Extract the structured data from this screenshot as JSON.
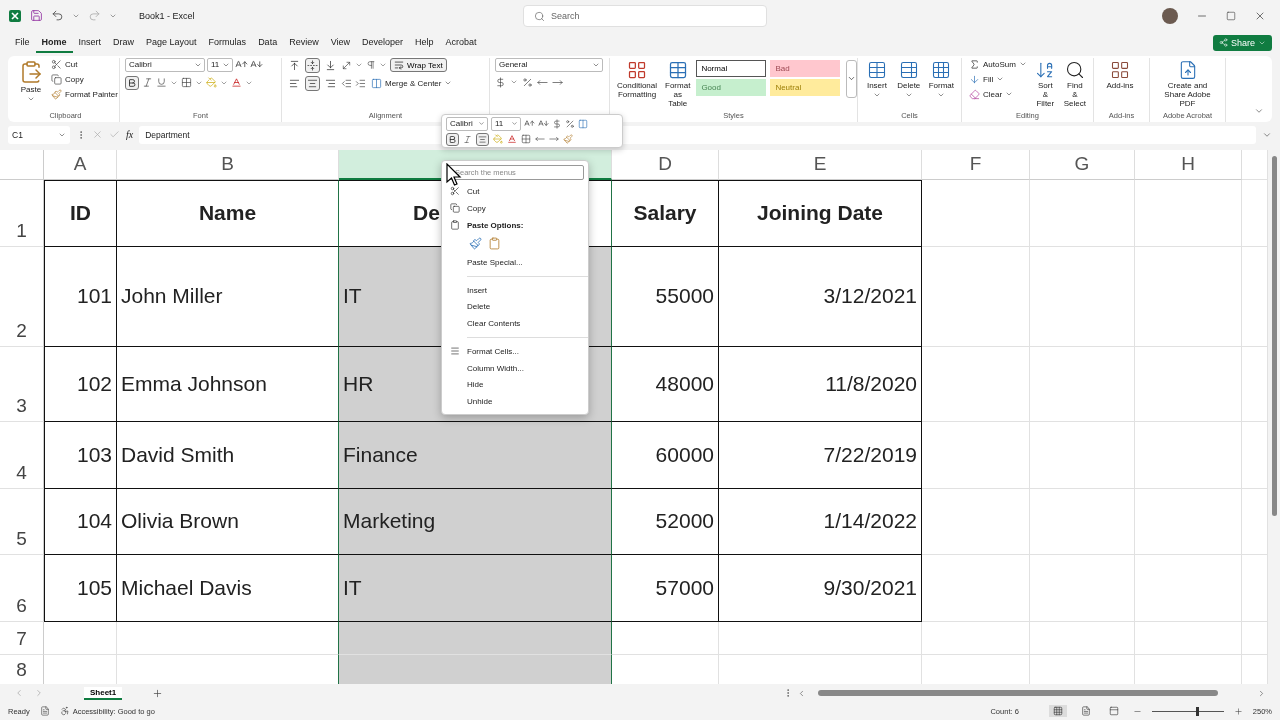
{
  "title_bar": {
    "title": "Book1  -  Excel",
    "search_placeholder": "Search"
  },
  "menu_tabs": [
    {
      "label": "File",
      "selected": false
    },
    {
      "label": "Home",
      "selected": true
    },
    {
      "label": "Insert",
      "selected": false
    },
    {
      "label": "Draw",
      "selected": false
    },
    {
      "label": "Page Layout",
      "selected": false
    },
    {
      "label": "Formulas",
      "selected": false
    },
    {
      "label": "Data",
      "selected": false
    },
    {
      "label": "Review",
      "selected": false
    },
    {
      "label": "View",
      "selected": false
    },
    {
      "label": "Developer",
      "selected": false
    },
    {
      "label": "Help",
      "selected": false
    },
    {
      "label": "Acrobat",
      "selected": false
    }
  ],
  "share_button": "Share",
  "ribbon": {
    "clipboard": {
      "label": "Clipboard",
      "paste": "Paste",
      "commands": [
        "Cut",
        "Copy",
        "Format Painter"
      ]
    },
    "font": {
      "label": "Font",
      "font_name": "Calibri",
      "font_size": "11",
      "bold_selected": true
    },
    "alignment": {
      "label": "Alignment",
      "vertical": [
        {
          "selected": false
        },
        {
          "selected": true
        },
        {
          "selected": false
        }
      ],
      "horizontal": [
        {
          "selected": false
        },
        {
          "selected": true
        },
        {
          "selected": false
        }
      ],
      "wrap_text": {
        "label": "Wrap Text",
        "selected": true
      },
      "merge": "Merge & Center"
    },
    "number": {
      "format": "General"
    },
    "styles": {
      "label": "Styles",
      "conditional": "Conditional Formatting",
      "format_table": "Format as Table",
      "cell_styles": [
        {
          "label": "Normal",
          "color": "#ffffff"
        },
        {
          "label": "Bad",
          "color": "#ffc7ce"
        },
        {
          "label": "Good",
          "color": "#c6efce"
        },
        {
          "label": "Neutral",
          "color": "#ffeb9c"
        }
      ]
    },
    "cells": {
      "label": "Cells",
      "commands": [
        "Insert",
        "Delete",
        "Format"
      ]
    },
    "editing": {
      "label": "Editing",
      "autosum": "AutoSum",
      "fill": "Fill",
      "clear": "Clear",
      "sort": "Sort & Filter",
      "find": "Find & Select"
    },
    "addins": {
      "label": "Add-ins",
      "button": "Add-ins"
    },
    "acrobat": {
      "label": "Adobe Acrobat",
      "button": "Create and Share Adobe PDF"
    }
  },
  "formula_bar": {
    "name_box": "C1",
    "fx": "fx",
    "value": "Department"
  },
  "sheet": {
    "columns": [
      {
        "label": "A",
        "selected": false,
        "numeric": true
      },
      {
        "label": "B",
        "selected": false,
        "numeric": false
      },
      {
        "selected": true,
        "numeric": false
      },
      {
        "label": "D",
        "selected": false,
        "numeric": true
      },
      {
        "label": "E",
        "selected": false,
        "numeric": true
      },
      {
        "label": "F",
        "selected": false
      },
      {
        "label": "G",
        "selected": false
      },
      {
        "label": "H",
        "selected": false
      }
    ],
    "rows": [
      {
        "label": "1",
        "kind": "header",
        "cells": [
          "ID",
          "Name",
          "De",
          "Salary",
          "Joining Date"
        ]
      },
      {
        "label": "2",
        "kind": "data",
        "cells": [
          "101",
          "John Miller",
          "IT",
          "55000",
          "3/12/2021"
        ]
      },
      {
        "label": "3",
        "kind": "data",
        "cells": [
          "102",
          "Emma Johnson",
          "HR",
          "48000",
          "11/8/2020"
        ]
      },
      {
        "label": "4",
        "kind": "data",
        "cells": [
          "103",
          "David Smith",
          "Finance",
          "60000",
          "7/22/2019"
        ]
      },
      {
        "label": "5",
        "kind": "data",
        "cells": [
          "104",
          "Olivia Brown",
          "Marketing",
          "52000",
          "1/14/2022"
        ]
      },
      {
        "label": "6",
        "kind": "data",
        "cells": [
          "105",
          "Michael Davis",
          "IT",
          "57000",
          "9/30/2021"
        ]
      },
      {
        "label": "7",
        "kind": "empty"
      },
      {
        "label": "8",
        "kind": "empty"
      }
    ]
  },
  "mini_toolbar": {
    "font_name": "Calibri",
    "font_size": "11",
    "bold_selected": true,
    "center_selected": true
  },
  "context_menu": {
    "search_placeholder": "Search the menus",
    "items": [
      {
        "kind": "command",
        "label": "Cut"
      },
      {
        "kind": "command",
        "label": "Copy"
      },
      {
        "kind": "header",
        "label": "Paste Options:"
      },
      {
        "kind": "paste_icons"
      },
      {
        "kind": "command",
        "label": "Paste Special..."
      },
      {
        "kind": "separator"
      },
      {
        "kind": "command",
        "label": "Insert"
      },
      {
        "kind": "command",
        "label": "Delete"
      },
      {
        "kind": "command",
        "label": "Clear Contents"
      },
      {
        "kind": "separator"
      },
      {
        "kind": "command",
        "label": "Format Cells..."
      },
      {
        "kind": "command",
        "label": "Column Width..."
      },
      {
        "kind": "command",
        "label": "Hide"
      },
      {
        "kind": "command",
        "label": "Unhide"
      }
    ]
  },
  "sheet_tabs": [
    {
      "label": "Sheet1",
      "selected": true
    }
  ],
  "status_bar": {
    "mode": "Ready",
    "accessibility": "Accessibility: Good to go",
    "count": "Count: 6",
    "views": [
      {
        "selected": true
      },
      {
        "selected": false
      },
      {
        "selected": false
      }
    ],
    "zoom": {
      "level": 0.63,
      "reading": "250%"
    }
  }
}
